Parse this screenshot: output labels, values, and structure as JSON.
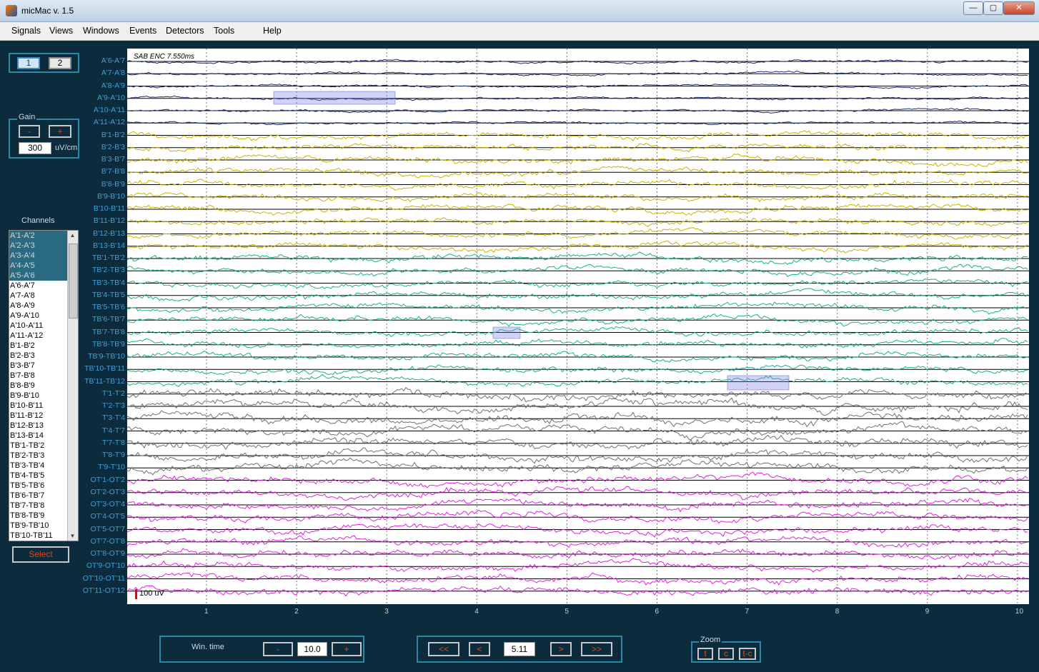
{
  "window": {
    "title": "micMac v. 1.5",
    "controls": [
      "—",
      "▢",
      "✕"
    ]
  },
  "menu": [
    "Signals",
    "Views",
    "Windows",
    "Events",
    "Detectors",
    "Tools",
    "Help"
  ],
  "pages": {
    "b1": "1",
    "b2": "2"
  },
  "gain": {
    "label": "Gain",
    "minus": "-",
    "plus": "+",
    "value": "300",
    "unit": "uV/cm"
  },
  "channels_panel": {
    "title": "Channels",
    "items": [
      "A'1-A'2",
      "A'2-A'3",
      "A'3-A'4",
      "A'4-A'5",
      "A'5-A'6",
      "A'6-A'7",
      "A'7-A'8",
      "A'8-A'9",
      "A'9-A'10",
      "A'10-A'11",
      "A'11-A'12",
      "B'1-B'2",
      "B'2-B'3",
      "B'3-B'7",
      "B'7-B'8",
      "B'8-B'9",
      "B'9-B'10",
      "B'10-B'11",
      "B'11-B'12",
      "B'12-B'13",
      "B'13-B'14",
      "TB'1-TB'2",
      "TB'2-TB'3",
      "TB'3-TB'4",
      "TB'4-TB'5",
      "TB'5-TB'6",
      "TB'6-TB'7",
      "TB'7-TB'8",
      "TB'8-TB'9",
      "TB'9-TB'10",
      "TB'10-TB'11"
    ],
    "selected_count": 5,
    "select_button": "Select"
  },
  "plot": {
    "title": "SAB ENC 7.550ms",
    "scale_label": "100 uV",
    "x_ticks": [
      "1",
      "2",
      "3",
      "4",
      "5",
      "6",
      "7",
      "8",
      "9",
      "10"
    ],
    "channels": [
      "A'6-A'7",
      "A'7-A'8",
      "A'8-A'9",
      "A'9-A'10",
      "A'10-A'11",
      "A'11-A'12",
      "B'1-B'2",
      "B'2-B'3",
      "B'3-B'7",
      "B'7-B'8",
      "B'8-B'9",
      "B'9-B'10",
      "B'10-B'11",
      "B'11-B'12",
      "B'12-B'13",
      "B'13-B'14",
      "TB'1-TB'2",
      "TB'2-TB'3",
      "TB'3-TB'4",
      "TB'4-TB'5",
      "TB'5-TB'6",
      "TB'6-TB'7",
      "TB'7-TB'8",
      "TB'8-TB'9",
      "TB'9-TB'10",
      "TB'10-TB'11",
      "TB'11-TB'12",
      "T'1-T'2",
      "T'2-T'3",
      "T'3-T'4",
      "T'4-T'7",
      "T'7-T'8",
      "T'8-T'9",
      "T'9-T'10",
      "OT'1-OT'2",
      "OT'2-OT'3",
      "OT'3-OT'4",
      "OT'4-OT'5",
      "OT'5-OT'7",
      "OT'7-OT'8",
      "OT'8-OT'9",
      "OT'9-OT'10",
      "OT'10-OT'11",
      "OT'11-OT'12"
    ],
    "group_colors": {
      "A": "#1a2a78",
      "B": "#c8b400",
      "TB": "#18b08c",
      "T": "#707070",
      "OT": "#e020e0"
    }
  },
  "wintime": {
    "label": "Win. time",
    "minus": "-",
    "value": "10.0",
    "plus": "+"
  },
  "nav": {
    "first": "<<",
    "prev": "<",
    "value": "5.11",
    "next": ">",
    "last": ">>"
  },
  "zoom": {
    "label": "Zoom",
    "t": "t",
    "c": "c",
    "tc": "t-c"
  }
}
